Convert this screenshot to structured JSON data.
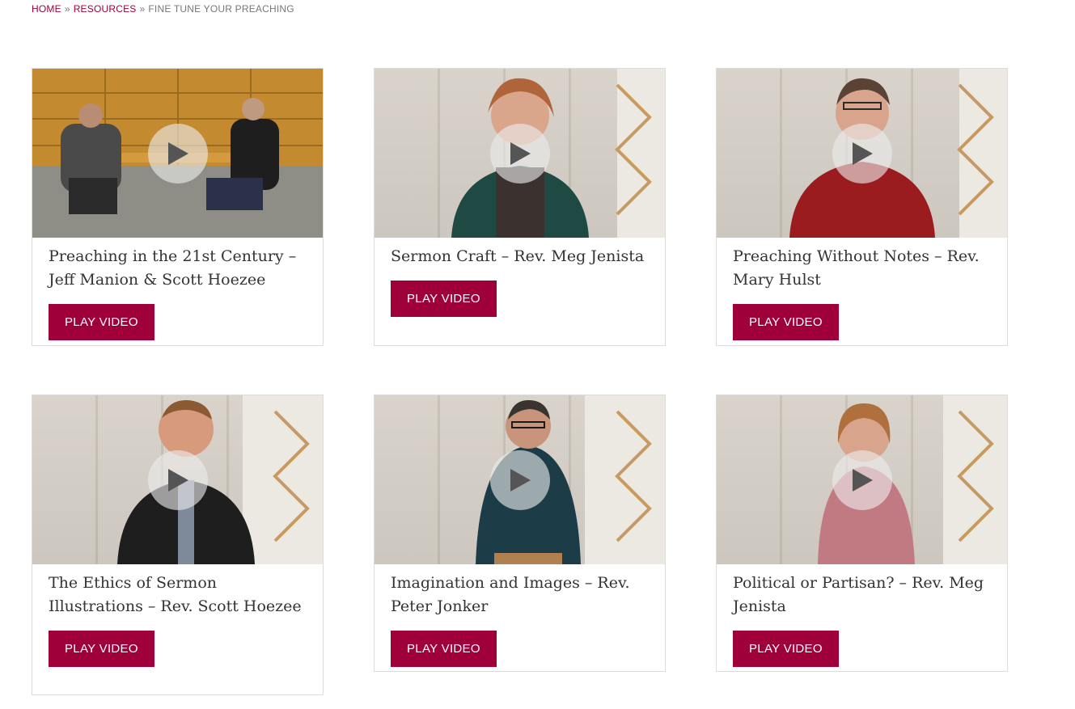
{
  "breadcrumb": {
    "home": "HOME",
    "separator": "»",
    "resources": "RESOURCES",
    "current": "FINE TUNE YOUR PREACHING"
  },
  "colors": {
    "accent": "#a0003a",
    "card_border": "#dcdcdc",
    "title_text": "#333333"
  },
  "videos": [
    {
      "title": "Preaching in the 21st Century – Jeff Manion & Scott Hoezee",
      "button": "PLAY VIDEO",
      "icon": "play-icon"
    },
    {
      "title": "Sermon Craft – Rev. Meg Jenista",
      "button": "PLAY VIDEO",
      "icon": "play-icon"
    },
    {
      "title": "Preaching Without Notes – Rev. Mary Hulst",
      "button": "PLAY VIDEO",
      "icon": "play-icon"
    },
    {
      "title": "The Ethics of Sermon Illustrations – Rev. Scott Hoezee",
      "button": "PLAY VIDEO",
      "icon": "play-icon"
    },
    {
      "title": "Imagination and Images – Rev. Peter Jonker",
      "button": "PLAY VIDEO",
      "icon": "play-icon"
    },
    {
      "title": "Political or Partisan? – Rev. Meg Jenista",
      "button": "PLAY VIDEO",
      "icon": "play-icon"
    }
  ]
}
